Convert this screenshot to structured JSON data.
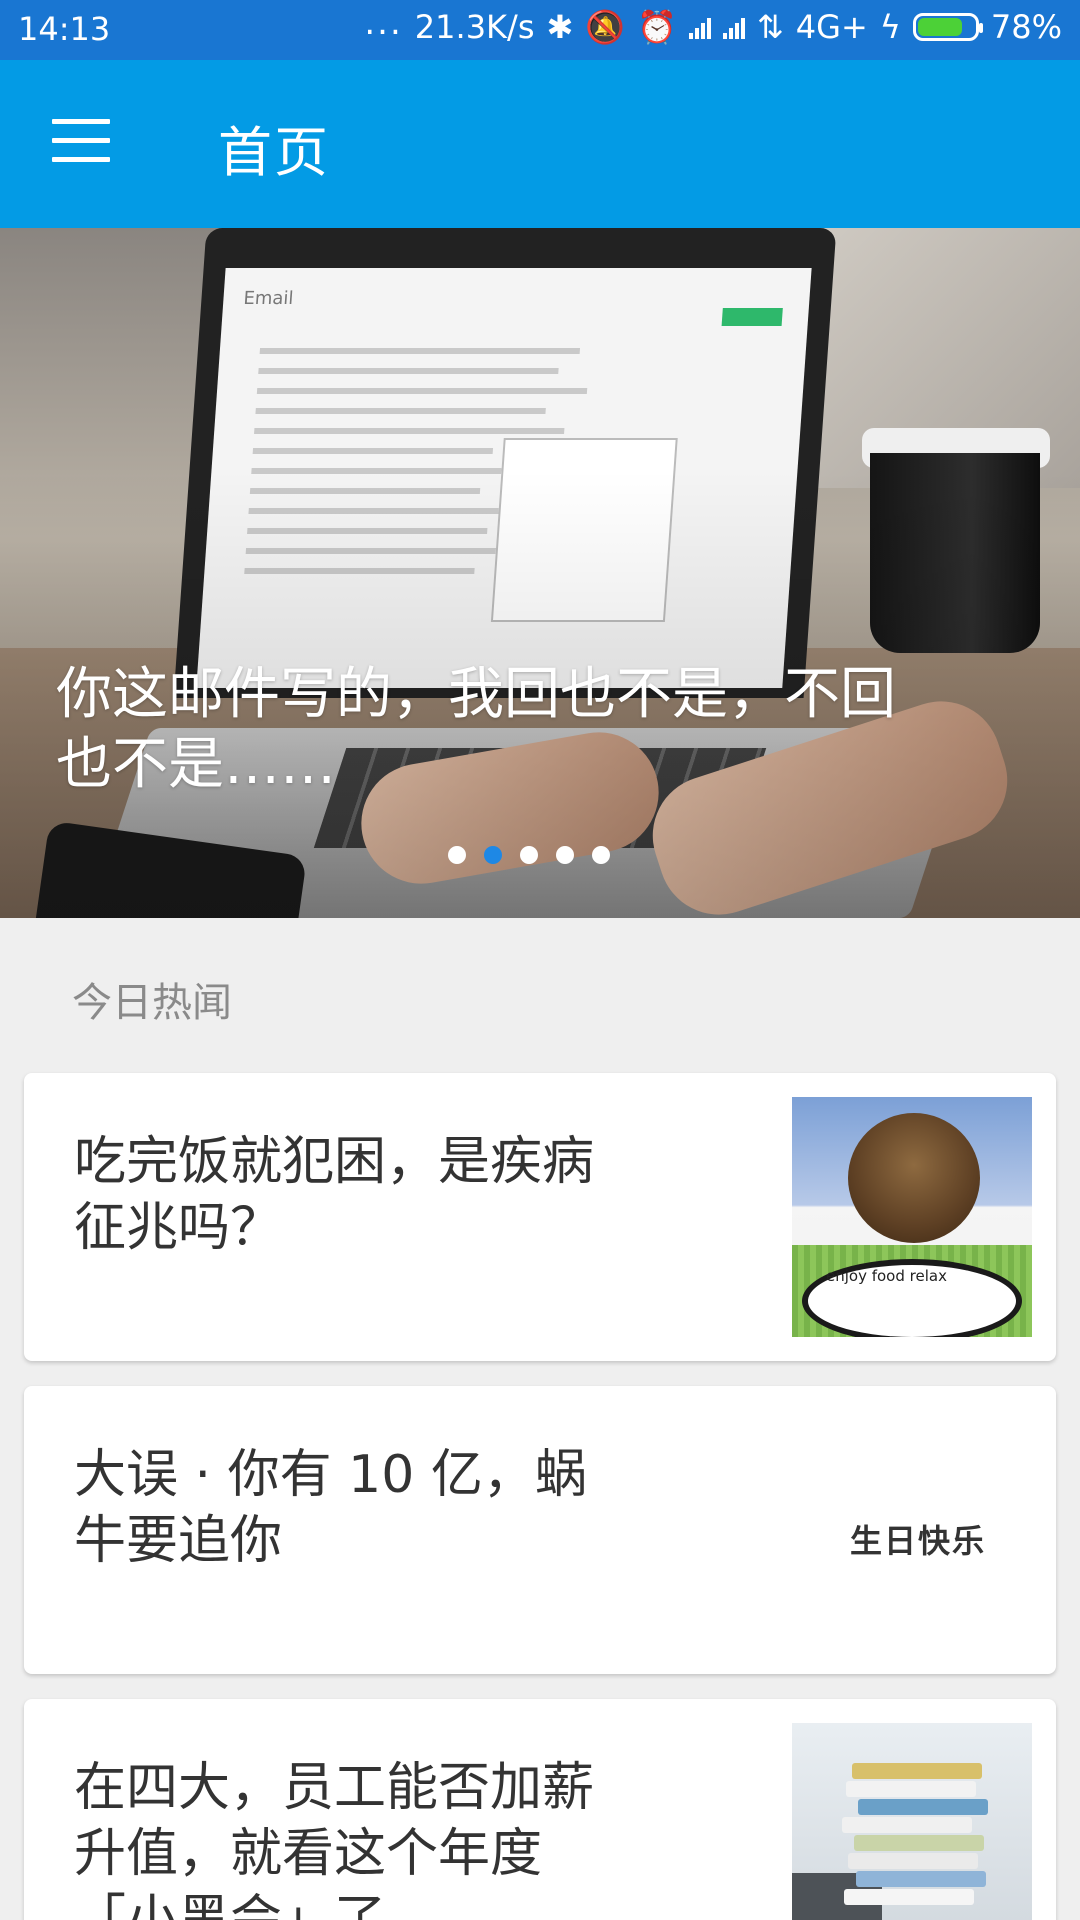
{
  "status_bar": {
    "time": "14:13",
    "dots": "...",
    "network_speed": "21.3K/s",
    "network_type": "4G+",
    "battery_percent": "78%",
    "battery_level": 0.78,
    "icons": [
      "bluetooth-icon",
      "mute-icon",
      "alarm-icon",
      "signal-icon",
      "signal-icon",
      "data-arrows-icon",
      "charging-icon",
      "battery-icon"
    ]
  },
  "app_bar": {
    "title": "首页",
    "menu_icon": "hamburger-menu-icon"
  },
  "banner": {
    "caption": "你这邮件写的，我回也不是，不回也不是……",
    "pages": 5,
    "active_page": 2,
    "image": "laptop-email-photo"
  },
  "section": {
    "title": "今日热闻"
  },
  "news": [
    {
      "title": "吃完饭就犯困，是疾病征兆吗？",
      "image": "sleeping-man-at-table-photo"
    },
    {
      "title": "大误 · 你有 10 亿，蜗牛要追你",
      "image_label": "生日快乐"
    },
    {
      "title": "在四大，员工能否加薪升值，就看这个年度「小黑会」了",
      "image": "paper-stack-office-photo"
    }
  ],
  "colors": {
    "status_bar": "#1976d2",
    "app_bar": "#039be5",
    "background": "#efefef",
    "pager_active": "#1e88e5"
  }
}
